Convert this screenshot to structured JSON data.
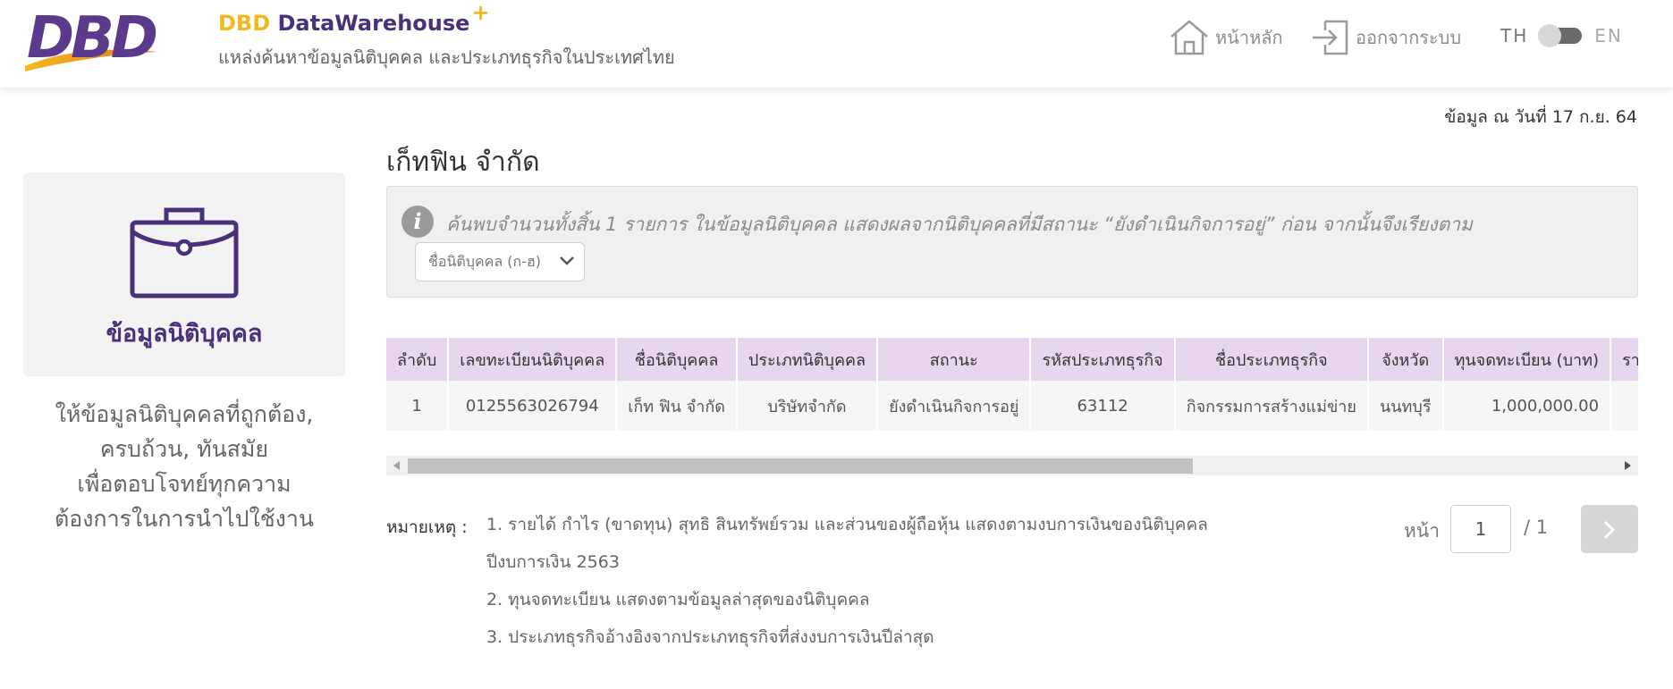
{
  "header": {
    "brand_prefix": "DBD",
    "brand_name": "DataWarehouse",
    "brand_plus": "+",
    "subtitle": "แหล่งค้นหาข้อมูลนิติบุคคล และประเภทธุรกิจในประเทศไทย",
    "nav_home": "หน้าหลัก",
    "nav_logout": "ออกจากระบบ",
    "lang_th": "TH",
    "lang_en": "EN",
    "logo_text": "DBD"
  },
  "as_of": "ข้อมูล ณ วันที่ 17 ก.ย. 64",
  "left_panel": {
    "title": "ข้อมูลนิติบุคคล",
    "desc_lines": [
      "ให้ข้อมูลนิติบุคคลที่ถูกต้อง,",
      "ครบถ้วน, ทันสมัย",
      "เพื่อตอบโจทย์ทุกความ",
      "ต้องการในการนำไปใช้งาน"
    ]
  },
  "company_title": "เก็ทฟิน จำกัด",
  "info": {
    "text": "ค้นพบจำนวนทั้งสิ้น 1 รายการ ในข้อมูลนิติบุคคล แสดงผลจากนิติบุคคลที่มีสถานะ “ยังดำเนินกิจการอยู่” ก่อน จากนั้นจึงเรียงตาม",
    "sort_selected": "ชื่อนิติบุคคล (ก-ฮ)"
  },
  "table": {
    "headers": [
      "ลำดับ",
      "เลขทะเบียนนิติบุคคล",
      "ชื่อนิติบุคคล",
      "ประเภทนิติบุคคล",
      "สถานะ",
      "รหัสประเภทธุรกิจ",
      "ชื่อประเภทธุรกิจ",
      "จังหวัด",
      "ทุนจดทะเบียน (บาท)",
      "รายได้รวม (บาท)"
    ],
    "rows": [
      [
        "1",
        "0125563026794",
        "เก็ท ฟิน จำกัด",
        "บริษัทจำกัด",
        "ยังดำเนินกิจการอยู่",
        "63112",
        "กิจกรรมการสร้างแม่ข่าย",
        "นนทบุรี",
        "1,000,000.00",
        ""
      ]
    ]
  },
  "notes": {
    "label": "หมายเหตุ :",
    "items": [
      "1. รายได้ กำไร (ขาดทุน) สุทธิ สินทรัพย์รวม และส่วนของผู้ถือหุ้น แสดงตามงบการเงินของนิติบุคคล",
      "ปีงบการเงิน 2563",
      "2. ทุนจดทะเบียน แสดงตามข้อมูลล่าสุดของนิติบุคคล",
      "3. ประเภทธุรกิจอ้างอิงจากประเภทธุรกิจที่ส่งงบการเงินปีล่าสุด"
    ]
  },
  "pagination": {
    "label": "หน้า",
    "current": "1",
    "total": "/ 1"
  },
  "colors": {
    "brand_purple": "#4a2f7a",
    "brand_yellow": "#f3b81f",
    "table_header": "#e6d7ef"
  },
  "icons": {
    "home": "home-icon",
    "logout": "logout-icon",
    "briefcase": "briefcase-icon",
    "info": "info-icon",
    "next": "chevron-right-icon"
  }
}
